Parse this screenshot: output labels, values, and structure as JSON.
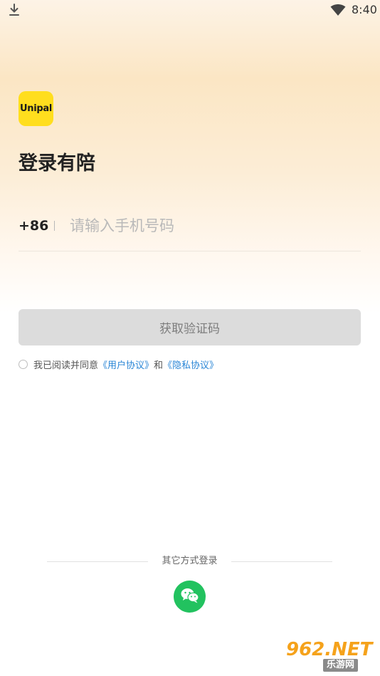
{
  "status_bar": {
    "time": "8:40",
    "icons": [
      "download-icon",
      "wifi-icon"
    ]
  },
  "logo": {
    "text": "Unipal",
    "color": "#ffde1e"
  },
  "title": "登录有陪",
  "phone": {
    "country_code": "+86",
    "value": "",
    "placeholder": "请输入手机号码"
  },
  "get_code_button": {
    "label": "获取验证码"
  },
  "agreement": {
    "checked": false,
    "prefix": "我已阅读并同意",
    "user_agreement": "《用户协议》",
    "and": "和",
    "privacy_policy": "《隐私协议》"
  },
  "other_login": {
    "label": "其它方式登录",
    "methods": [
      "wechat-icon"
    ]
  },
  "watermark": {
    "top": "962.NET",
    "bottom": "乐游网"
  },
  "colors": {
    "accent": "#ffde1e",
    "link": "#2a86d6",
    "wechat": "#22c25f",
    "button_disabled": "#dcdcdc"
  }
}
